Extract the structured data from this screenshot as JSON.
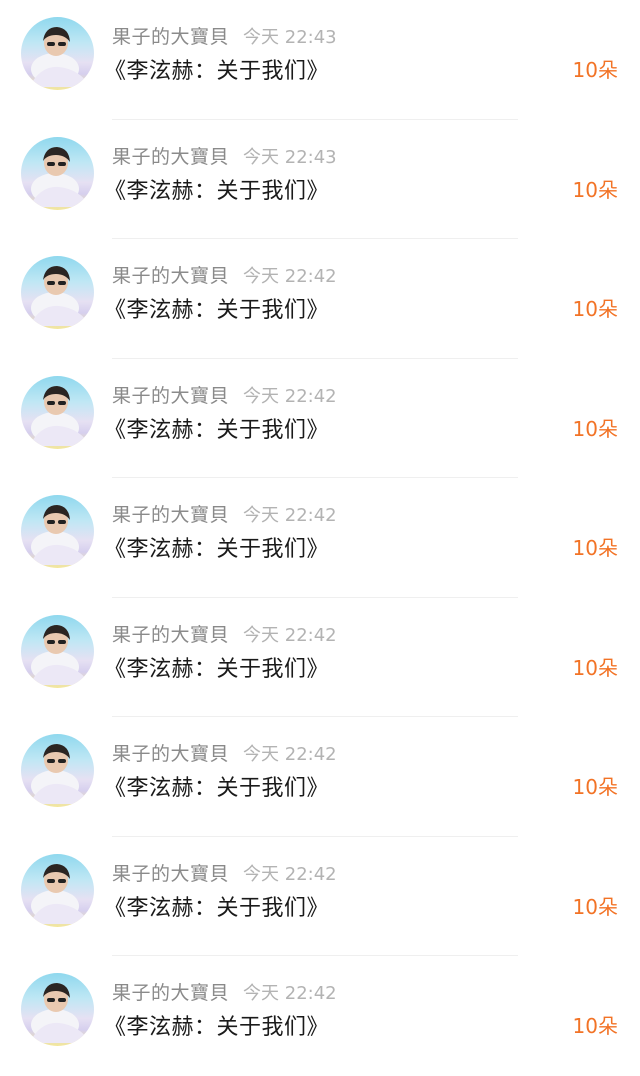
{
  "colors": {
    "username": "#8a8a8a",
    "time": "#b3b3b3",
    "title": "#1a1a1a",
    "count": "#f27326",
    "divider": "#efefef"
  },
  "rows": [
    {
      "avatar_icon": "user-avatar-photo",
      "username": "果子的大寶貝",
      "time": "今天 22:43",
      "title": "《李泫赫：关于我们》",
      "count": "10朵"
    },
    {
      "avatar_icon": "user-avatar-photo",
      "username": "果子的大寶貝",
      "time": "今天 22:43",
      "title": "《李泫赫：关于我们》",
      "count": "10朵"
    },
    {
      "avatar_icon": "user-avatar-photo",
      "username": "果子的大寶貝",
      "time": "今天 22:42",
      "title": "《李泫赫：关于我们》",
      "count": "10朵"
    },
    {
      "avatar_icon": "user-avatar-photo",
      "username": "果子的大寶貝",
      "time": "今天 22:42",
      "title": "《李泫赫：关于我们》",
      "count": "10朵"
    },
    {
      "avatar_icon": "user-avatar-photo",
      "username": "果子的大寶貝",
      "time": "今天 22:42",
      "title": "《李泫赫：关于我们》",
      "count": "10朵"
    },
    {
      "avatar_icon": "user-avatar-photo",
      "username": "果子的大寶貝",
      "time": "今天 22:42",
      "title": "《李泫赫：关于我们》",
      "count": "10朵"
    },
    {
      "avatar_icon": "user-avatar-photo",
      "username": "果子的大寶貝",
      "time": "今天 22:42",
      "title": "《李泫赫：关于我们》",
      "count": "10朵"
    },
    {
      "avatar_icon": "user-avatar-photo",
      "username": "果子的大寶貝",
      "time": "今天 22:42",
      "title": "《李泫赫：关于我们》",
      "count": "10朵"
    },
    {
      "avatar_icon": "user-avatar-photo",
      "username": "果子的大寶貝",
      "time": "今天 22:42",
      "title": "《李泫赫：关于我们》",
      "count": "10朵"
    }
  ]
}
